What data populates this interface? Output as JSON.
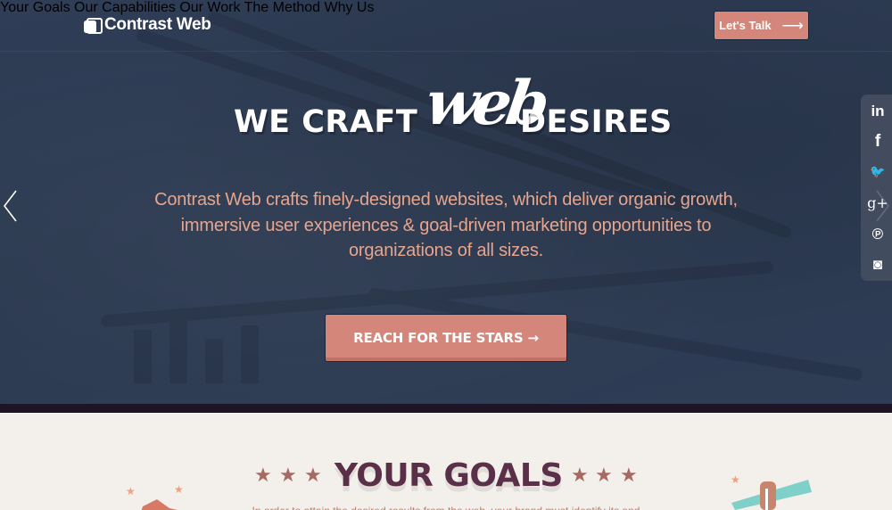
{
  "brand": {
    "name": "Contrast Web",
    "logo_icon": "overlapping-squares-icon"
  },
  "nav": {
    "items": [
      {
        "label": "Your Goals"
      },
      {
        "label": "Our Capabilities"
      },
      {
        "label": "Our Work"
      },
      {
        "label": "The Method"
      },
      {
        "label": "Why Us"
      }
    ],
    "cta": {
      "label": "Let's Talk",
      "icon": "arrow-right-icon"
    }
  },
  "hero": {
    "headline_left": "WE CRAFT",
    "headline_script": "web",
    "headline_right": "DESIRES",
    "subtitle": "Contrast Web crafts finely-designed websites, which deliver organic growth, immersive user experiences & goal-driven marketing opportunities to organizations of all sizes.",
    "cta": {
      "label": "REACH FOR THE STARS →"
    },
    "carousel": {
      "prev_icon": "chevron-left-icon",
      "next_icon": "chevron-right-icon"
    }
  },
  "social": {
    "items": [
      {
        "name": "linkedin",
        "glyph": "in"
      },
      {
        "name": "facebook",
        "glyph": "f"
      },
      {
        "name": "twitter",
        "glyph": "🐦"
      },
      {
        "name": "google-plus",
        "glyph": "g+"
      },
      {
        "name": "pinterest",
        "glyph": "℗"
      },
      {
        "name": "instagram",
        "glyph": "◙"
      }
    ]
  },
  "goals": {
    "title": "YOUR GOALS",
    "stars": "★",
    "intro": "In order to attain the desired results from the web, your brand must identify its and"
  },
  "colors": {
    "hero_bg": "#2c3a52",
    "accent": "#d4867a",
    "subtitle": "#e8a58d",
    "goals_title": "#5a3049",
    "goals_bg": "#f3efeb",
    "divider": "#1e1424"
  }
}
